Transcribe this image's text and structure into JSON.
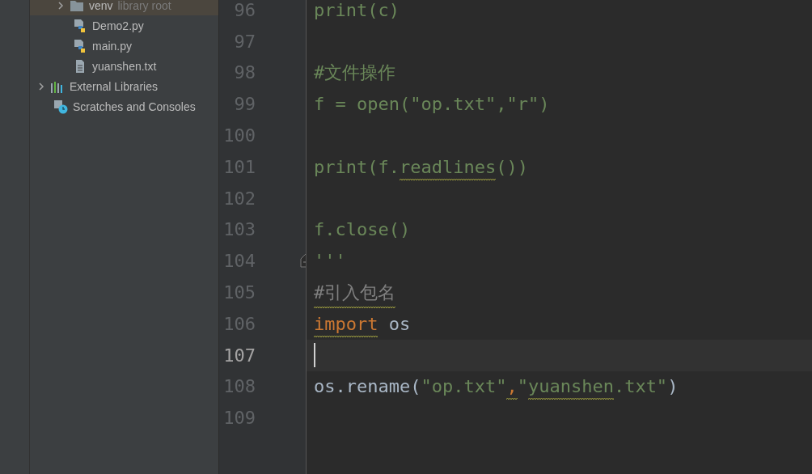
{
  "project_tree": {
    "items": [
      {
        "label": "venv",
        "suffix": "library root",
        "kind": "folder",
        "expanded": false,
        "selected": true
      },
      {
        "label": "Demo2.py",
        "kind": "python",
        "selected": false
      },
      {
        "label": "main.py",
        "kind": "python",
        "selected": false
      },
      {
        "label": "yuanshen.txt",
        "kind": "text",
        "selected": false
      },
      {
        "label": "External Libraries",
        "kind": "libraries",
        "expanded": false,
        "selected": false
      },
      {
        "label": "Scratches and Consoles",
        "kind": "scratches",
        "selected": false
      }
    ]
  },
  "editor": {
    "lines": [
      {
        "number": "96",
        "current": false,
        "fold": false,
        "tokens": [
          {
            "text": "print(c)",
            "kind": "string",
            "squiggle": false
          }
        ]
      },
      {
        "number": "97",
        "current": false,
        "fold": false
      },
      {
        "number": "98",
        "current": false,
        "fold": false,
        "tokens": [
          {
            "text": "#文件操作",
            "kind": "string",
            "squiggle": false
          }
        ]
      },
      {
        "number": "99",
        "current": false,
        "fold": false,
        "tokens": [
          {
            "text": "f = open(\"op.txt\",\"r\")",
            "kind": "string",
            "squiggle": false
          }
        ]
      },
      {
        "number": "100",
        "current": false,
        "fold": false
      },
      {
        "number": "101",
        "current": false,
        "fold": false,
        "tokens": [
          {
            "text": "print(f.",
            "kind": "string",
            "squiggle": false
          },
          {
            "text": "readlines",
            "kind": "string",
            "squiggle": true
          },
          {
            "text": "())",
            "kind": "string",
            "squiggle": false
          }
        ]
      },
      {
        "number": "102",
        "current": false,
        "fold": false
      },
      {
        "number": "103",
        "current": false,
        "fold": false,
        "tokens": [
          {
            "text": "f.close()",
            "kind": "string",
            "squiggle": false
          }
        ]
      },
      {
        "number": "104",
        "current": false,
        "fold": true,
        "tokens": [
          {
            "text": "'''",
            "kind": "string",
            "squiggle": false
          }
        ]
      },
      {
        "number": "105",
        "current": false,
        "fold": false,
        "tokens": [
          {
            "text": "#引入包名",
            "kind": "comment",
            "squiggle": true
          }
        ]
      },
      {
        "number": "106",
        "current": false,
        "fold": false,
        "tokens": [
          {
            "text": "import",
            "kind": "keyword",
            "squiggle": true
          },
          {
            "text": " os",
            "kind": "plain",
            "squiggle": false
          }
        ]
      },
      {
        "number": "107",
        "current": true,
        "fold": false
      },
      {
        "number": "108",
        "current": false,
        "fold": false,
        "tokens": [
          {
            "text": "os.rename(",
            "kind": "plain",
            "squiggle": false
          },
          {
            "text": "\"op.txt\"",
            "kind": "string",
            "squiggle": false
          },
          {
            "text": ",",
            "kind": "keyword",
            "squiggle": true
          },
          {
            "text": "\"",
            "kind": "string",
            "squiggle": false
          },
          {
            "text": "yuanshen",
            "kind": "string",
            "squiggle": true
          },
          {
            "text": ".txt\"",
            "kind": "string",
            "squiggle": false
          },
          {
            "text": ")",
            "kind": "plain",
            "squiggle": false
          }
        ]
      },
      {
        "number": "109",
        "current": false,
        "fold": false
      }
    ]
  }
}
